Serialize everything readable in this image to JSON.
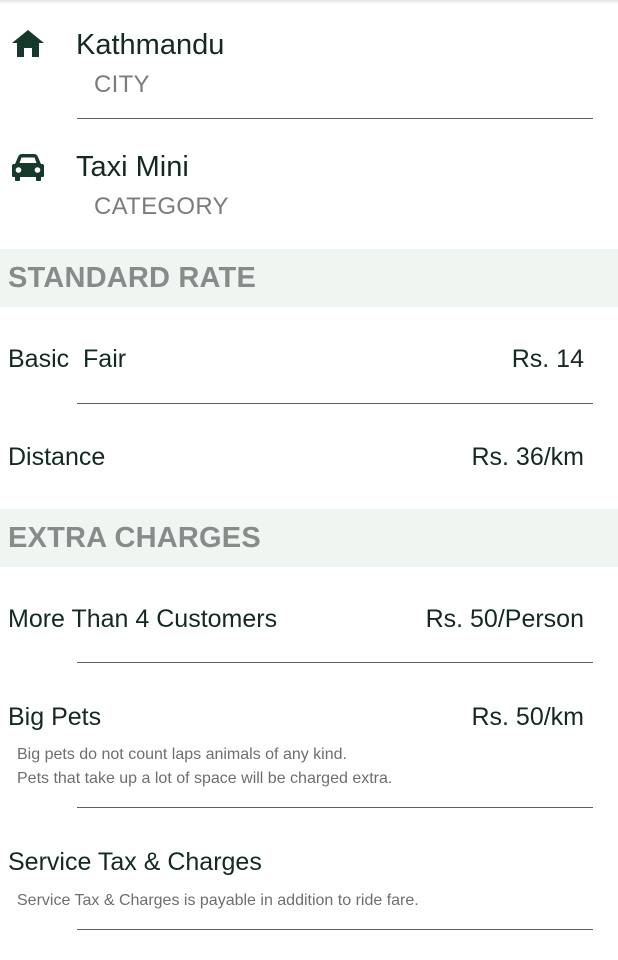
{
  "city": {
    "icon": "home-icon",
    "value": "Kathmandu",
    "label": "CITY"
  },
  "category": {
    "icon": "car-icon",
    "value": "Taxi Mini",
    "label": "CATEGORY"
  },
  "standard_rate": {
    "header": "STANDARD RATE",
    "rows": [
      {
        "label": "Basic  Fair",
        "value": "Rs. 14"
      },
      {
        "label": "Distance",
        "value": "Rs. 36/km"
      }
    ]
  },
  "extra_charges": {
    "header": "EXTRA CHARGES",
    "rows": [
      {
        "label": "More Than 4 Customers",
        "value": "Rs. 50/Person"
      },
      {
        "label": "Big Pets",
        "value": "Rs. 50/km",
        "note_lines": [
          "Big pets do not count laps animals of any kind.",
          "Pets that take up a lot of space will be charged extra."
        ]
      },
      {
        "label": "Service Tax & Charges",
        "note_lines": [
          "Service Tax & Charges is payable in addition to ride fare."
        ]
      }
    ]
  },
  "colors": {
    "accent_dark_green": "#16392c",
    "section_background": "#eff5f1",
    "section_text": "#868c89",
    "divider": "#5f5f5f"
  }
}
